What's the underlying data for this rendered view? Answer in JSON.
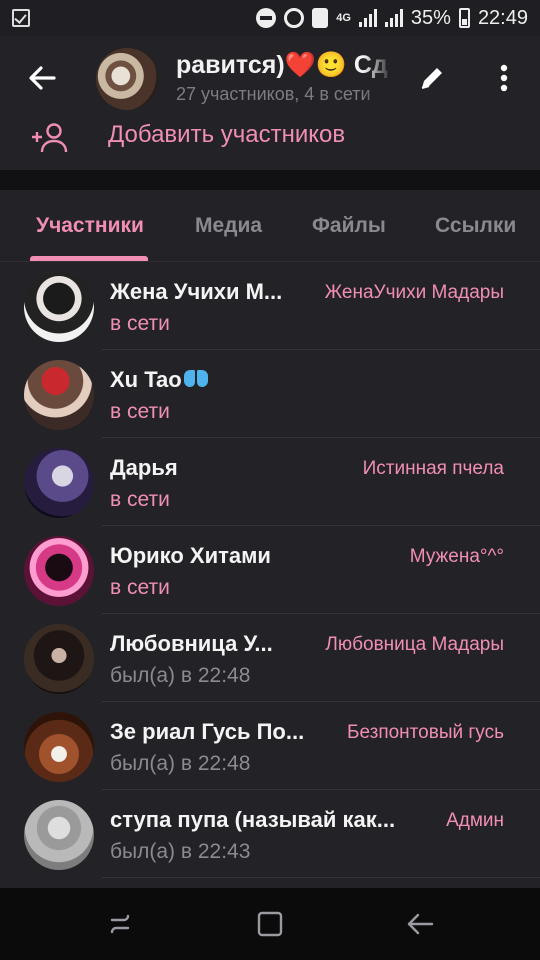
{
  "status_bar": {
    "battery": "35%",
    "time": "22:49",
    "network": "4G"
  },
  "header": {
    "title": "равится)❤️🙂   Сд",
    "subtitle": "27 участников, 4 в сети"
  },
  "add_members_label": "Добавить участников",
  "tabs": [
    {
      "label": "Участники",
      "active": true
    },
    {
      "label": "Медиа",
      "active": false
    },
    {
      "label": "Файлы",
      "active": false
    },
    {
      "label": "Ссылки",
      "active": false
    }
  ],
  "members": [
    {
      "name": "Жена Учихи М...",
      "status": "в сети",
      "online": true,
      "role": "ЖенаУчихи Мадары"
    },
    {
      "name": "Xu Tao",
      "status": "в сети",
      "online": true,
      "role": "",
      "icon": "butterfly-icon"
    },
    {
      "name": "Дарья",
      "status": "в сети",
      "online": true,
      "role": "Истинная пчела"
    },
    {
      "name": "Юрико Хитами",
      "status": "в сети",
      "online": true,
      "role": "Мужена°^°"
    },
    {
      "name": "Любовница У...",
      "status": "был(а) в 22:48",
      "online": false,
      "role": "Любовница Мадары"
    },
    {
      "name": "Зе риал Гусь По...",
      "status": "был(а) в 22:48",
      "online": false,
      "role": "Безпонтовый гусь"
    },
    {
      "name": "ступа пупа (называй как...",
      "status": "был(а) в 22:43",
      "online": false,
      "role": "Админ"
    }
  ],
  "colors": {
    "accent": "#f08eb4",
    "background": "#232226",
    "muted_text": "#8b8a90"
  },
  "icons": {
    "back": "arrow-left-icon",
    "edit": "pencil-icon",
    "menu": "more-vert-icon",
    "add_member": "person-add-icon",
    "nav": [
      "recents-icon",
      "home-icon",
      "back-icon"
    ]
  }
}
